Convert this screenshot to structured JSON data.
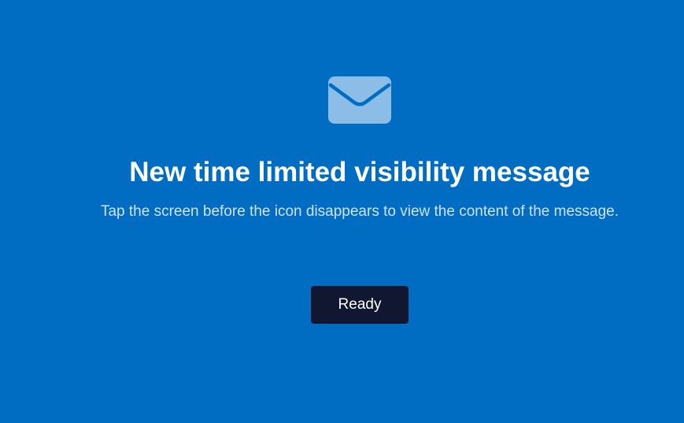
{
  "icon": "envelope-icon",
  "colors": {
    "background": "#006dc3",
    "icon": "#8cbde6",
    "title": "#ffffff",
    "subtitle": "#cfe2f6",
    "button_background": "#111730",
    "button_text": "#ffffff"
  },
  "message": {
    "title": "New time limited visibility message",
    "instruction": "Tap the screen before the icon disappears to view the content of the message."
  },
  "actions": {
    "ready_label": "Ready"
  }
}
